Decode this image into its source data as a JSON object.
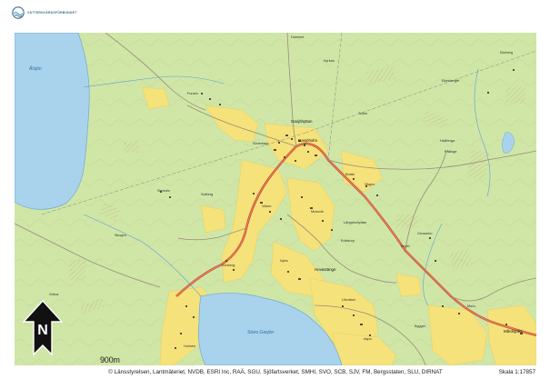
{
  "header": {
    "logo_text": "VÄTTERNVÅRDSFÖRBUNDET"
  },
  "map": {
    "place_labels": {
      "gaxjohyttan": "Gaxjöhyttan",
      "gaxjo": "Gaxjöholm",
      "hovasten": "Hovastänge",
      "sonnarp": "Sörlemarp",
      "vistorp": "Viston",
      "stensbo": "Stensbo",
      "manvik": "Mossvik",
      "karlberg": "Karlberg",
      "ulvnas": "Ulvnäset",
      "bratte": "Bratte",
      "solberg": "Solberg",
      "marsundet": "Mårdsjöbo",
      "langebo": "Långebohyttan",
      "erikstorp": "Erikstorp",
      "hallberg": "Hallberga",
      "pallinge": "Pållinge",
      "ekeberg": "Ekeberg",
      "grossebo": "Grossebo",
      "ekesberg": "Ekesberget",
      "dammet": "Dammet",
      "kyrkan": "Kyrkan",
      "forsen": "Forsen",
      "sagen": "Sågen",
      "nybo": "Nybo",
      "torp": "Torpet",
      "grava": "Gräva",
      "holmen": "Holmen",
      "aspa": "Aspa",
      "skogen": "Skogen",
      "mora": "Mora",
      "bygget": "Bygget",
      "tullen": "Tullen"
    },
    "water_labels": {
      "lake_west": "Ålsjön",
      "lake_south": "Stora Gaxjön"
    },
    "colors": {
      "forest": "#cfe6a6",
      "open_land": "#f5e27a",
      "water": "#a9d3ec",
      "road_main": "#c0462a",
      "road_minor": "#9a8c7a",
      "contour": "#b7a57e",
      "buildings": "#5a4a3a"
    }
  },
  "north_arrow": {
    "letter": "N",
    "icon": "north-arrow-icon"
  },
  "scale_bar_text": "900m",
  "footer": {
    "attribution": "© Länsstyrelsen, Lantmäteriet, NVDB, ESRI Inc, RAÄ, SGU, Sjöfartsverket, SMHI, SVO, SCB, SJV, FM, Bergsstaten, SLU, DIRNAT",
    "scale": "Skala 1:17857"
  }
}
